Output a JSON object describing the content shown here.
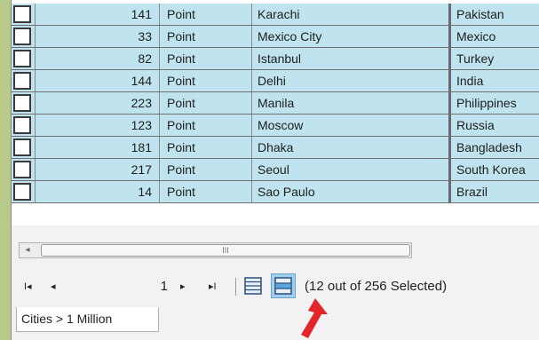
{
  "table": {
    "rows": [
      {
        "id": "141",
        "shape": "Point",
        "name": "Karachi",
        "country": "Pakistan"
      },
      {
        "id": "33",
        "shape": "Point",
        "name": "Mexico City",
        "country": "Mexico"
      },
      {
        "id": "82",
        "shape": "Point",
        "name": "Istanbul",
        "country": "Turkey"
      },
      {
        "id": "144",
        "shape": "Point",
        "name": "Delhi",
        "country": "India"
      },
      {
        "id": "223",
        "shape": "Point",
        "name": "Manila",
        "country": "Philippines"
      },
      {
        "id": "123",
        "shape": "Point",
        "name": "Moscow",
        "country": "Russia"
      },
      {
        "id": "181",
        "shape": "Point",
        "name": "Dhaka",
        "country": "Bangladesh"
      },
      {
        "id": "217",
        "shape": "Point",
        "name": "Seoul",
        "country": "South Korea"
      },
      {
        "id": "14",
        "shape": "Point",
        "name": "Sao Paulo",
        "country": "Brazil"
      }
    ]
  },
  "scrollbar": {
    "left_arrow": "◂",
    "grip": "III"
  },
  "navigation": {
    "first_icon": "first-page-icon",
    "prev_icon": "previous-page-icon",
    "next_icon": "next-page-icon",
    "last_icon": "last-page-icon",
    "first_glyph": "I◂",
    "prev_glyph": "◂",
    "next_glyph": "▸",
    "last_glyph": "▸I",
    "page": "1"
  },
  "view_toggle": {
    "show_all_icon": "show-all-records-icon",
    "show_selected_icon": "show-selected-records-icon"
  },
  "selection_status": "(12 out of 256 Selected)",
  "tab": {
    "label": "Cities > 1 Million"
  },
  "colors": {
    "row_selected": "#bfe3ef",
    "highlight": "#9fd0f0",
    "arrow": "#e3242b",
    "background": "#b9c98a"
  }
}
